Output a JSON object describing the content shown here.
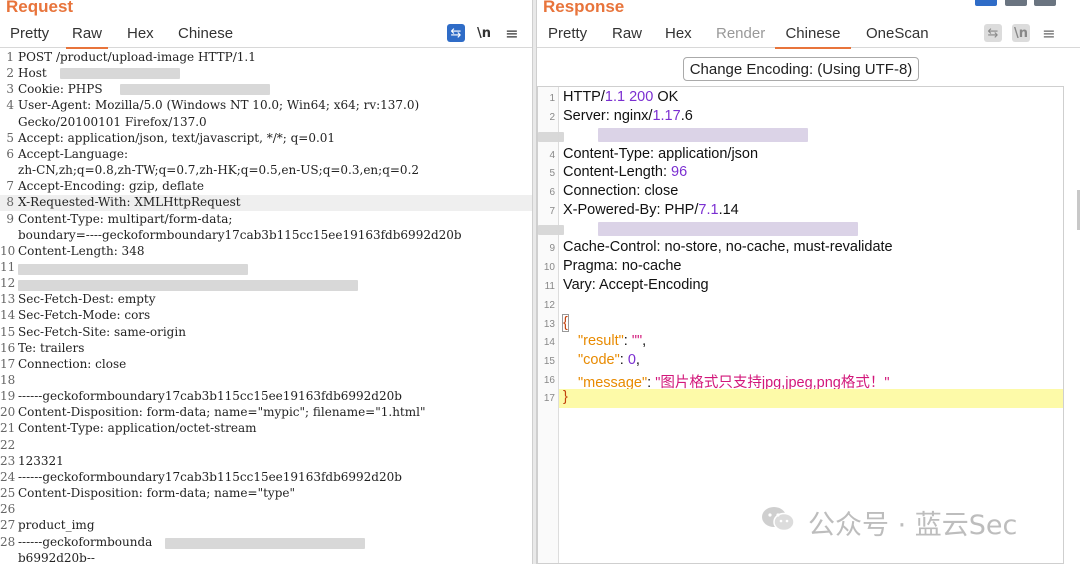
{
  "request": {
    "title": "Request",
    "tabs": [
      "Pretty",
      "Raw",
      "Hex",
      "Chinese"
    ],
    "active_tab": "Raw",
    "tools": {
      "wrap": "⇆",
      "newline": "\\n",
      "menu": "≡"
    },
    "lines": [
      {
        "n": "1",
        "t": "POST /product/upload-image HTTP/1.1"
      },
      {
        "n": "2",
        "t": "Host"
      },
      {
        "n": "3",
        "t": "Cookie: PHPS"
      },
      {
        "n": "4",
        "t": "User-Agent: Mozilla/5.0 (Windows NT 10.0; Win64; x64; rv:137.0)"
      },
      {
        "n": "",
        "t": "Gecko/20100101 Firefox/137.0"
      },
      {
        "n": "5",
        "t": "Accept: application/json, text/javascript, */*; q=0.01"
      },
      {
        "n": "6",
        "t": "Accept-Language:"
      },
      {
        "n": "",
        "t": "zh-CN,zh;q=0.8,zh-TW;q=0.7,zh-HK;q=0.5,en-US;q=0.3,en;q=0.2"
      },
      {
        "n": "7",
        "t": "Accept-Encoding: gzip, deflate"
      },
      {
        "n": "8",
        "t": "X-Requested-With: XMLHttpRequest"
      },
      {
        "n": "9",
        "t": "Content-Type: multipart/form-data;"
      },
      {
        "n": "",
        "t": "boundary=----geckoformboundary17cab3b115cc15ee19163fdb6992d20b"
      },
      {
        "n": "10",
        "t": "Content-Length: 348"
      },
      {
        "n": "11",
        "t": ""
      },
      {
        "n": "12",
        "t": ""
      },
      {
        "n": "13",
        "t": "Sec-Fetch-Dest: empty"
      },
      {
        "n": "14",
        "t": "Sec-Fetch-Mode: cors"
      },
      {
        "n": "15",
        "t": "Sec-Fetch-Site: same-origin"
      },
      {
        "n": "16",
        "t": "Te: trailers"
      },
      {
        "n": "17",
        "t": "Connection: close"
      },
      {
        "n": "18",
        "t": ""
      },
      {
        "n": "19",
        "t": "------geckoformboundary17cab3b115cc15ee19163fdb6992d20b"
      },
      {
        "n": "20",
        "t": "Content-Disposition: form-data; name=\"mypic\"; filename=\"1.html\""
      },
      {
        "n": "21",
        "t": "Content-Type: application/octet-stream"
      },
      {
        "n": "22",
        "t": ""
      },
      {
        "n": "23",
        "t": "123321"
      },
      {
        "n": "24",
        "t": "------geckoformboundary17cab3b115cc15ee19163fdb6992d20b"
      },
      {
        "n": "25",
        "t": "Content-Disposition: form-data; name=\"type\""
      },
      {
        "n": "26",
        "t": ""
      },
      {
        "n": "27",
        "t": "product_img"
      },
      {
        "n": "28",
        "t": "------geckoformbounda"
      },
      {
        "n": "",
        "t": "b6992d20b--"
      }
    ]
  },
  "response": {
    "title": "Response",
    "tabs": [
      "Pretty",
      "Raw",
      "Hex",
      "Render",
      "Chinese",
      "OneScan"
    ],
    "active_tab": "Chinese",
    "encoding_button": "Change Encoding: (Using UTF-8)",
    "tools": {
      "wrap": "⇆",
      "newline": "\\n",
      "menu": "≡"
    },
    "status": {
      "proto": "HTTP/",
      "ver": "1.1",
      "code": "200",
      "msg": "OK"
    },
    "server": {
      "k": "Server: nginx/",
      "v": "1.17",
      "r": ".6"
    },
    "content_type": "Content-Type: application/json",
    "content_length": {
      "k": "Content-Length: ",
      "v": "96"
    },
    "connection": "Connection: close",
    "powered": {
      "k": "X-Powered-By: PHP/",
      "v": "7.1",
      "r": ".14"
    },
    "cache_control": "Cache-Control: no-store, no-cache, must-revalidate",
    "pragma": "Pragma: no-cache",
    "vary": "Vary: Accept-Encoding",
    "json": {
      "open": "{",
      "close": "}",
      "result_key": "\"result\"",
      "result_val": "\"\"",
      "code_key": "\"code\"",
      "code_val": "0",
      "message_key": "\"message\"",
      "message_val": "\"图片格式只支持jpg,jpeg,png格式！\""
    }
  },
  "watermark": "公众号 · 蓝云Sec"
}
